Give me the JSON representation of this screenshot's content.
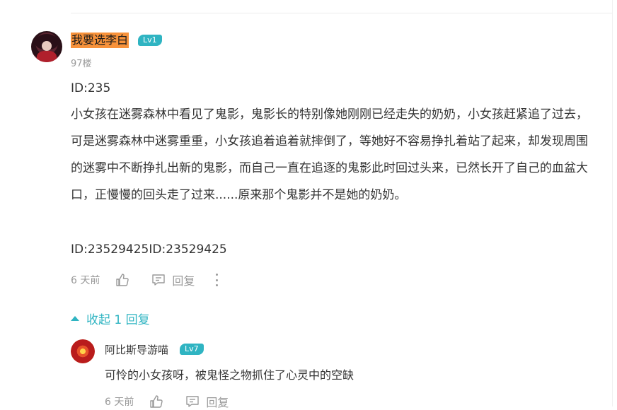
{
  "comment": {
    "username": "我要选李白",
    "level": "Lv1",
    "floor": "97楼",
    "id_line": "ID:235",
    "content": "小女孩在迷雾森林中看见了鬼影，鬼影长的特别像她刚刚已经走失的奶奶，小女孩赶紧追了过去，可是迷雾森林中迷雾重重，小女孩追着追着就摔倒了，等她好不容易挣扎着站了起来，却发现周围的迷雾中不断挣扎出新的鬼影，而自己一直在追逐的鬼影此时回过头来，已然长开了自己的血盆大口，正慢慢的回头走了过来......原来那个鬼影并不是她的奶奶。",
    "id_footer": "ID:23529425ID:23529425",
    "time": "6 天前",
    "reply_label": "回复"
  },
  "collapse_label": "收起 1 回复",
  "reply": {
    "username": "阿比斯导游喵",
    "level": "Lv7",
    "text": "可怜的小女孩呀，被鬼怪之物抓住了心灵中的空缺",
    "time": "6 天前",
    "reply_label": "回复"
  },
  "colors": {
    "accent": "#2fb4c2",
    "username_highlight": "#f7923b",
    "muted": "#999999"
  }
}
